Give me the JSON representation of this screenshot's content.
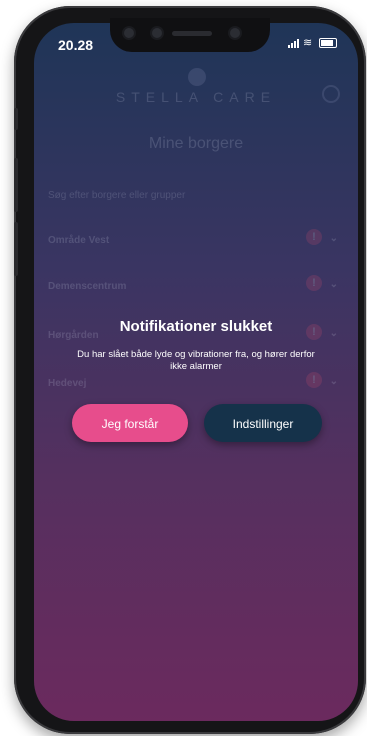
{
  "status_bar": {
    "time": "20.28"
  },
  "background_app": {
    "brand": "STELLA CARE",
    "title": "Mine borgere",
    "search_placeholder": "Søg efter borgere eller grupper",
    "list": [
      {
        "label": "Område Vest",
        "alert": "!"
      },
      {
        "label": "Demenscentrum",
        "alert": "!"
      },
      {
        "label": "Hørgården",
        "alert": "!"
      },
      {
        "label": "Hedevej",
        "alert": "!"
      }
    ]
  },
  "dialog": {
    "title": "Notifikationer slukket",
    "message": "Du har slået både lyde og vibrationer fra, og hører derfor ikke alarmer",
    "primary_button": "Jeg forstår",
    "secondary_button": "Indstillinger"
  },
  "colors": {
    "primary_button": "#e74d8c",
    "secondary_button": "#15324a",
    "gradient_top": "#1f3557",
    "gradient_bottom": "#6b2a5e"
  }
}
